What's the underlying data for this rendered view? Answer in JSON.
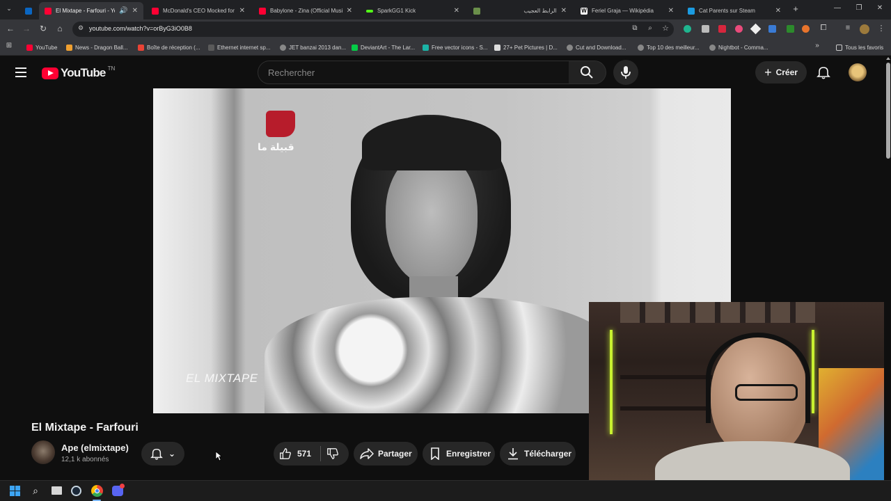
{
  "browser": {
    "tabs": [
      {
        "title": "",
        "color": "#0a66c2"
      },
      {
        "title": "El Mixtape - Farfouri - You",
        "color": "#ff0033",
        "active": true
      },
      {
        "title": "McDonald's CEO Mocked for",
        "color": "#ff0033"
      },
      {
        "title": "Babylone - Zina (Official Musi",
        "color": "#ff0033"
      },
      {
        "title": "SparkGG1 Kick",
        "color": "#53fc18"
      },
      {
        "title": "",
        "color": "#6a8f4a"
      },
      {
        "title": "الرابط العجيب",
        "color": "#888888"
      },
      {
        "title": "Feriel Graja — Wikipédia",
        "color": "#ffffff"
      },
      {
        "title": "Cat Parents sur Steam",
        "color": "#1b9be0"
      }
    ],
    "new_tab": "+",
    "address": "youtube.com/watch?v=orByG3iO0B8",
    "bookmarks": [
      "YouTube",
      "News - Dragon Ball...",
      "Boîte de réception (...",
      "Ethernet internet sp...",
      "JET banzai 2013 dan...",
      "DeviantArt - The Lar...",
      "Free vector icons - S...",
      "27+ Pet Pictures | D...",
      "Cut and Download...",
      "Top 10 des meilleur...",
      "Nightbot - Comma..."
    ],
    "all_bookmarks": "Tous les favoris"
  },
  "youtube": {
    "logo_text": "YouTube",
    "country_code": "TN",
    "search_placeholder": "Rechercher",
    "create_label": "Créer",
    "video": {
      "channel_logo_text": "قبيلة ما",
      "watermark": "EL MIXTAPE"
    },
    "title": "El Mixtape - Farfouri",
    "channel_name": "Ape (elmixtape)",
    "subscribers": "12,1 k abonnés",
    "likes": "571",
    "share_label": "Partager",
    "save_label": "Enregistrer",
    "download_label": "Télécharger"
  },
  "colors": {
    "brand_red": "#ff0033",
    "bg": "#0f0f0f"
  }
}
